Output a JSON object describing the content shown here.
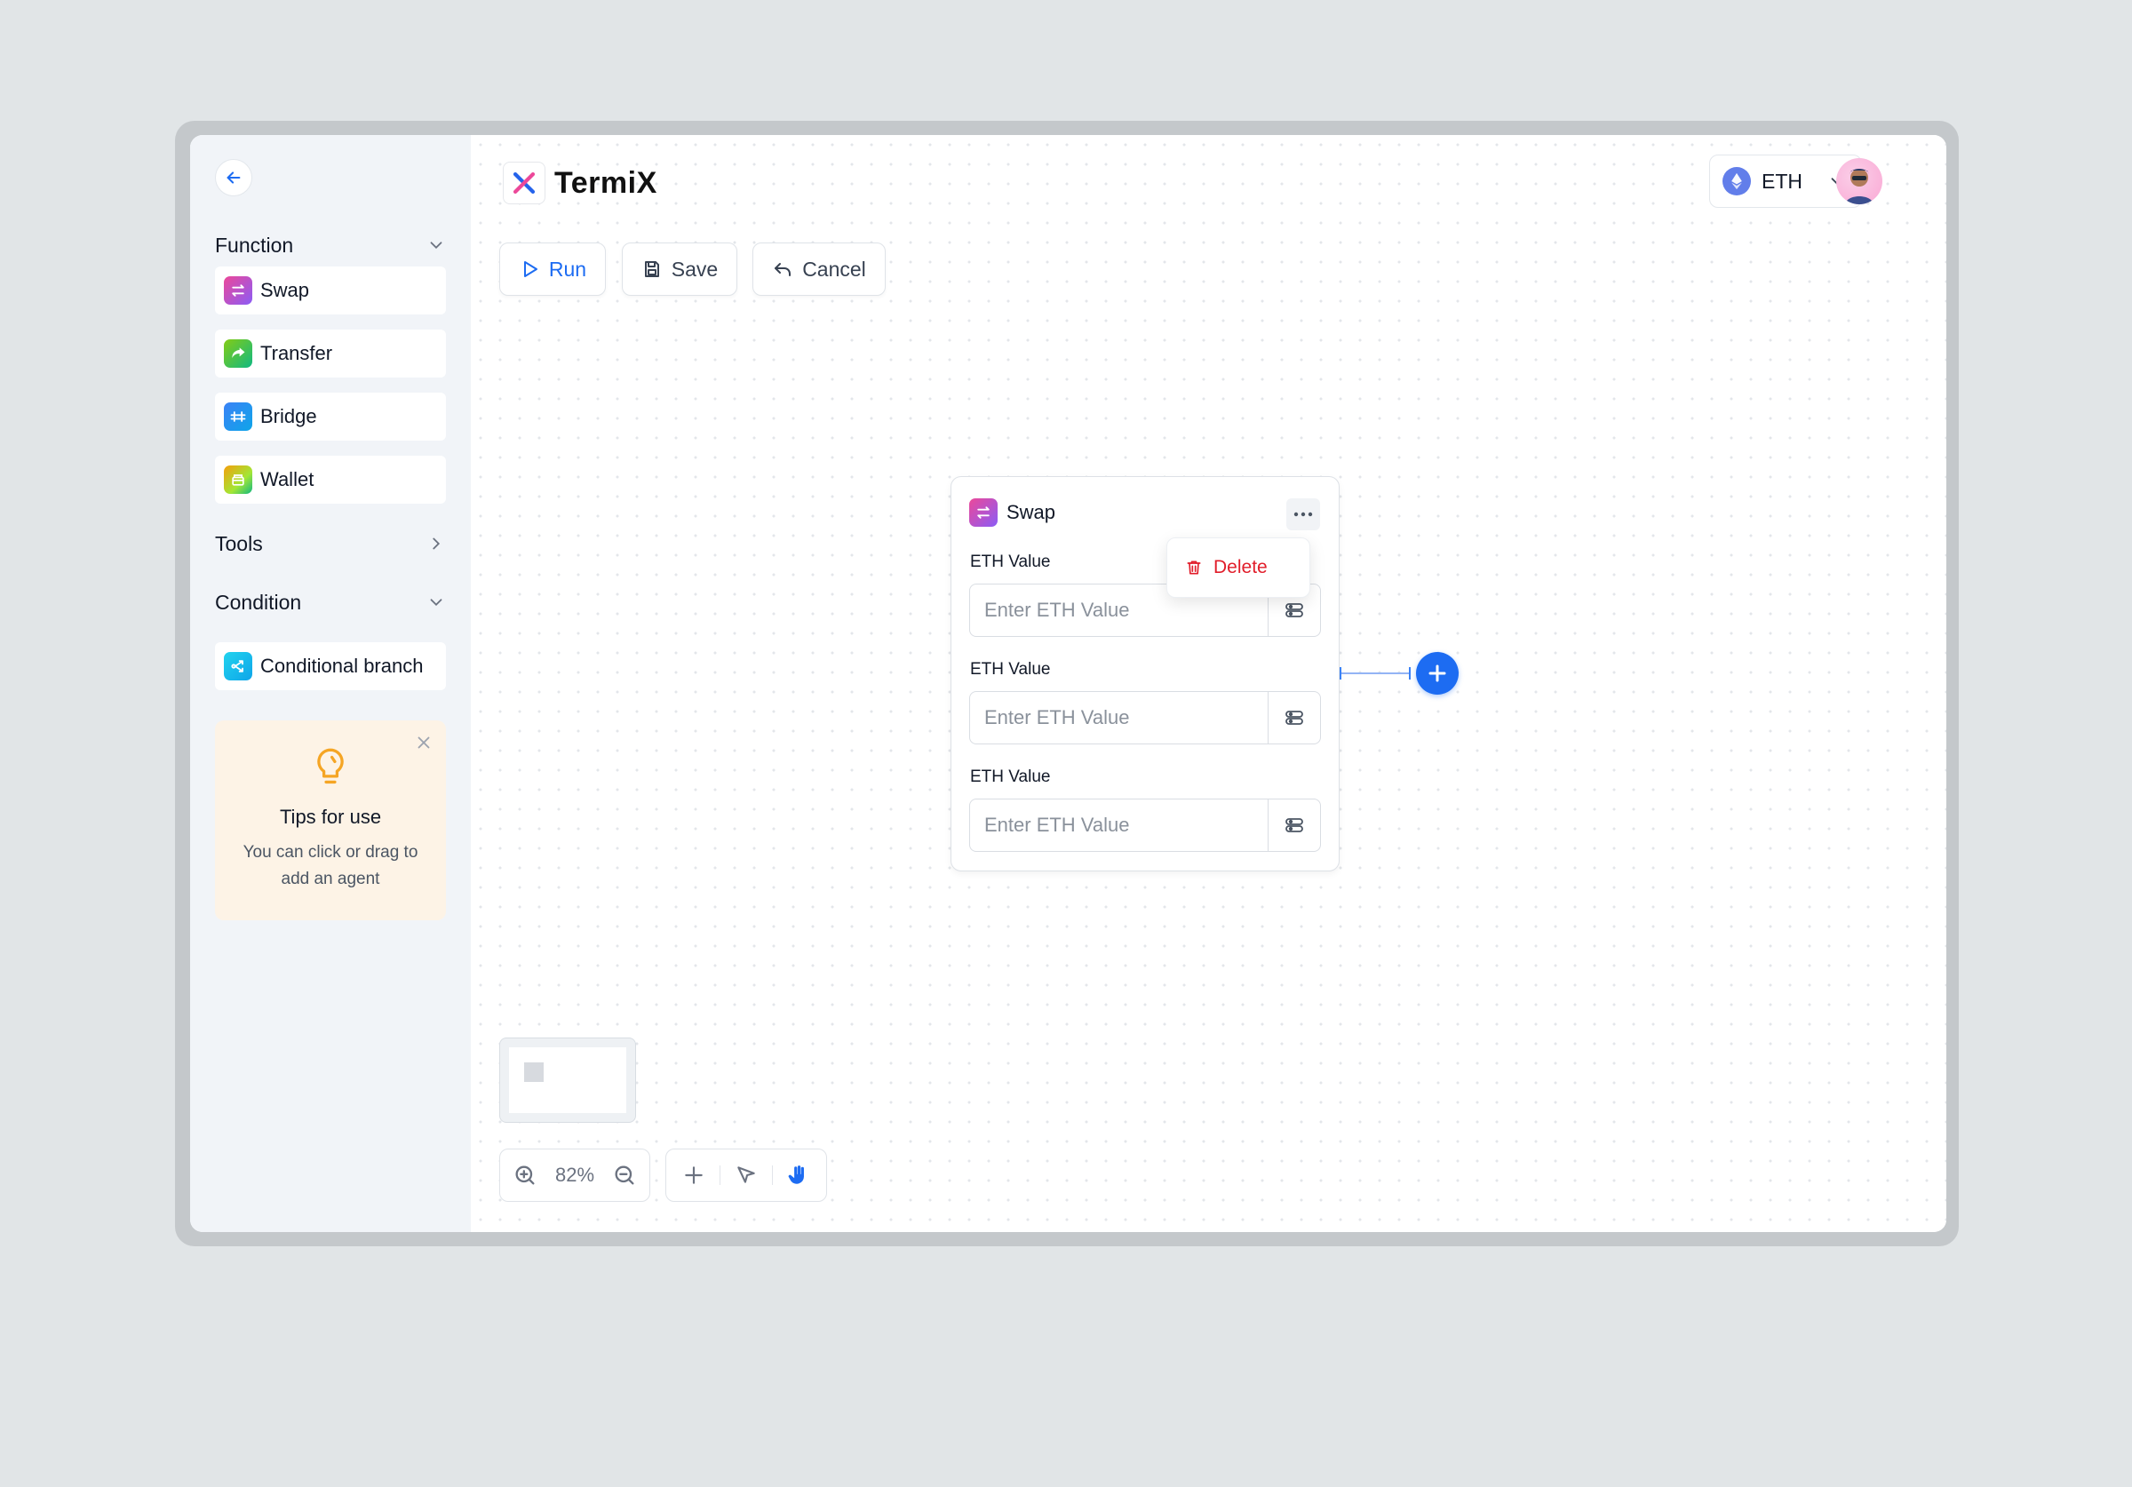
{
  "app": {
    "name": "TermiX"
  },
  "sidebar": {
    "sections": [
      {
        "title": "Function",
        "expanded": true,
        "items": [
          {
            "label": "Swap",
            "icon": "swap-icon",
            "color": "#a855f7"
          },
          {
            "label": "Transfer",
            "icon": "transfer-icon",
            "color": "#22c55e"
          },
          {
            "label": "Bridge",
            "icon": "bridge-icon",
            "color": "#1d9bf0"
          },
          {
            "label": "Wallet",
            "icon": "wallet-icon",
            "color": "#f59e0b"
          }
        ]
      },
      {
        "title": "Tools",
        "expanded": false,
        "items": []
      },
      {
        "title": "Condition",
        "expanded": true,
        "items": [
          {
            "label": "Conditional branch",
            "icon": "branch-icon",
            "color": "#06b6d4"
          }
        ]
      }
    ],
    "tips": {
      "title": "Tips for use",
      "text": "You can click or drag to add an agent"
    }
  },
  "header": {
    "network": "ETH",
    "network_icon": "ethereum-icon"
  },
  "toolbar": {
    "run_label": "Run",
    "save_label": "Save",
    "cancel_label": "Cancel"
  },
  "node": {
    "title": "Swap",
    "fields": [
      {
        "label": "ETH Value",
        "placeholder": "Enter ETH Value"
      },
      {
        "label": "ETH Value",
        "placeholder": "Enter ETH Value"
      },
      {
        "label": "ETH Value",
        "placeholder": "Enter ETH Value"
      }
    ],
    "menu": {
      "delete_label": "Delete"
    }
  },
  "zoom": {
    "level": "82%"
  },
  "colors": {
    "accent": "#1d6cf2",
    "danger": "#e11d2a",
    "tips_bg": "#fdf3e6"
  }
}
